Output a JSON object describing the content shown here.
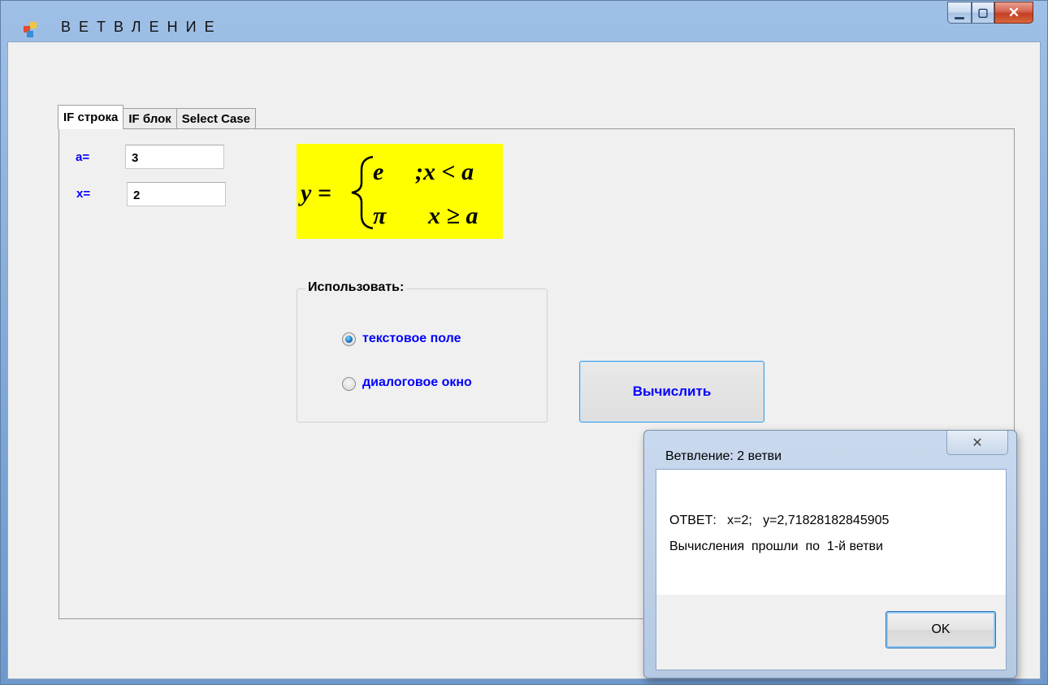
{
  "window": {
    "title": "ВЕТВЛЕНИЕ",
    "minimize_glyph": "▁",
    "maximize_glyph": "▢",
    "close_glyph": "✕"
  },
  "tabs": [
    {
      "label": "IF  строка",
      "active": true
    },
    {
      "label": "IF блок",
      "active": false
    },
    {
      "label": "Select  Case",
      "active": false
    }
  ],
  "inputs": {
    "a_label": "a=",
    "a_value": "3",
    "x_label": "x=",
    "x_value": "2"
  },
  "formula": {
    "lhs": "y =",
    "row1_value": "e",
    "row1_condition": ";x < a",
    "row2_value": "π",
    "row2_condition": "x ≥ a",
    "background": "#ffff00"
  },
  "group": {
    "title": "Использовать:",
    "options": [
      {
        "label": "текстовое  поле",
        "selected": true
      },
      {
        "label": "диалоговое  окно",
        "selected": false
      }
    ]
  },
  "calc_button": {
    "label": "Вычислить"
  },
  "message_box": {
    "title": "Ветвление: 2 ветви",
    "close_glyph": "✕",
    "line1": "ОТВЕТ:   x=2;   y=2,71828182845905",
    "line2": "Вычисления  прошли  по  1-й ветви",
    "ok_label": "OK"
  },
  "colors": {
    "accent_text": "#0000ff",
    "formula_bg": "#ffff00",
    "title_bar": "#8fb4e2",
    "close_button": "#c9482b"
  }
}
